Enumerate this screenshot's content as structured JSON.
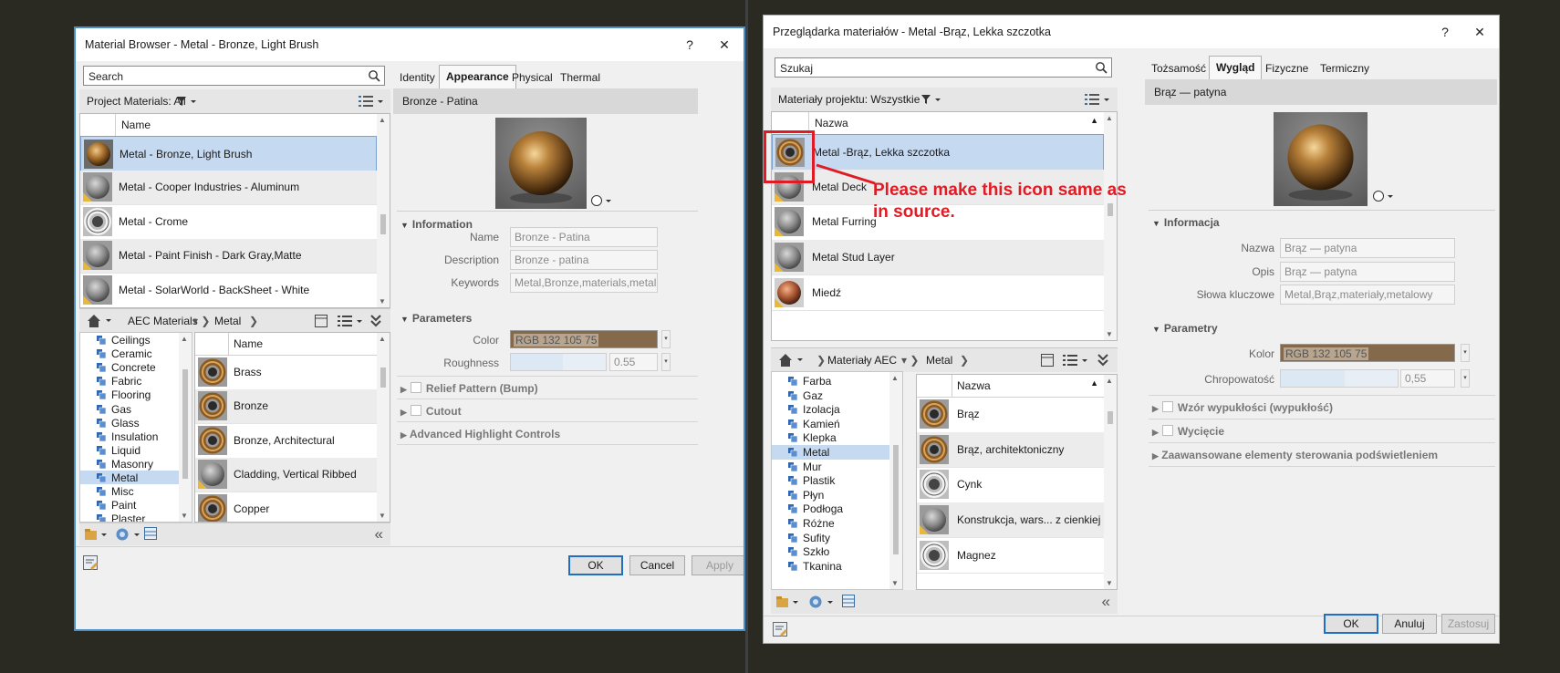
{
  "left_window": {
    "title": "Material Browser - Metal - Bronze, Light Brush",
    "help_label": "?",
    "close_label": "✕",
    "search": {
      "placeholder": "Search"
    },
    "project_materials_label": "Project Materials: All",
    "list_header": "Name",
    "project_items": [
      {
        "label": "Metal - Bronze, Light Brush",
        "thumb": "bronze-brush"
      },
      {
        "label": "Metal - Cooper Industries - Aluminum",
        "thumb": "gray-sphere"
      },
      {
        "label": "Metal - Crome",
        "thumb": "chrome-ring"
      },
      {
        "label": "Metal - Paint Finish - Dark Gray,Matte",
        "thumb": "gray-sphere"
      },
      {
        "label": "Metal - SolarWorld - BackSheet - White",
        "thumb": "gray-sphere"
      }
    ],
    "breadcrumb": [
      "AEC Materials",
      "Metal"
    ],
    "tree_items": [
      "Ceilings",
      "Ceramic",
      "Concrete",
      "Fabric",
      "Flooring",
      "Gas",
      "Glass",
      "Insulation",
      "Liquid",
      "Masonry",
      "Metal",
      "Misc",
      "Paint",
      "Plaster"
    ],
    "tree_selected": "Metal",
    "library_header": "Name",
    "library_items": [
      {
        "label": "Brass",
        "thumb": "ring"
      },
      {
        "label": "Bronze",
        "thumb": "ring"
      },
      {
        "label": "Bronze, Architectural",
        "thumb": "ring"
      },
      {
        "label": "Cladding, Vertical Ribbed",
        "thumb": "gray-sphere"
      },
      {
        "label": "Copper",
        "thumb": "ring"
      }
    ],
    "tabs": [
      "Identity",
      "Appearance",
      "Physical",
      "Thermal"
    ],
    "active_tab": "Appearance",
    "asset_name": "Bronze - Patina",
    "information_label": "Information",
    "fields": [
      {
        "label": "Name",
        "value": "Bronze - Patina"
      },
      {
        "label": "Description",
        "value": "Bronze - patina"
      },
      {
        "label": "Keywords",
        "value": "Metal,Bronze,materials,metal"
      }
    ],
    "parameters_label": "Parameters",
    "color_label": "Color",
    "color_value": "RGB 132 105 75",
    "roughness_label": "Roughness",
    "roughness_value": "0.55",
    "collapsed_sections": [
      "Relief Pattern (Bump)",
      "Cutout"
    ],
    "advanced_label": "Advanced Highlight Controls",
    "buttons": {
      "ok": "OK",
      "cancel": "Cancel",
      "apply": "Apply"
    }
  },
  "right_window": {
    "title": "Przeglądarka materiałów - Metal -Brąz, Lekka szczotka",
    "help_label": "?",
    "close_label": "✕",
    "search": {
      "placeholder": "Szukaj"
    },
    "project_materials_label": "Materiały projektu: Wszystkie",
    "list_header": "Nazwa",
    "project_items": [
      {
        "label": "Metal -Brąz, Lekka szczotka",
        "thumb": "ring"
      },
      {
        "label": "Metal Deck",
        "thumb": "gray-sphere"
      },
      {
        "label": "Metal Furring",
        "thumb": "gray-sphere"
      },
      {
        "label": "Metal Stud Layer",
        "thumb": "gray-sphere"
      },
      {
        "label": "Miedź",
        "thumb": "copper-sphere"
      }
    ],
    "breadcrumb": [
      "Materiały AEC",
      "Metal"
    ],
    "tree_items": [
      "Farba",
      "Gaz",
      "Izolacja",
      "Kamień",
      "Klepka",
      "Metal",
      "Mur",
      "Plastik",
      "Płyn",
      "Podłoga",
      "Różne",
      "Sufity",
      "Szkło",
      "Tkanina"
    ],
    "tree_selected": "Metal",
    "library_header": "Nazwa",
    "library_items": [
      {
        "label": "Brąz",
        "thumb": "ring"
      },
      {
        "label": "Brąz, architektoniczny",
        "thumb": "ring"
      },
      {
        "label": "Cynk",
        "thumb": "chrome-ring"
      },
      {
        "label": "Konstrukcja, wars... z cienkiej stali",
        "thumb": "gray-sphere"
      },
      {
        "label": "Magnez",
        "thumb": "chrome-ring"
      }
    ],
    "tabs": [
      "Tożsamość",
      "Wygląd",
      "Fizyczne",
      "Termiczny"
    ],
    "active_tab": "Wygląd",
    "asset_name": "Brąz — patyna",
    "information_label": "Informacja",
    "fields": [
      {
        "label": "Nazwa",
        "value": "Brąz — patyna"
      },
      {
        "label": "Opis",
        "value": "Brąz — patyna"
      },
      {
        "label": "Słowa kluczowe",
        "value": "Metal,Brąz,materiały,metalowy"
      }
    ],
    "parameters_label": "Parametry",
    "color_label": "Kolor",
    "color_value": "RGB 132 105 75",
    "roughness_label": "Chropowatość",
    "roughness_value": "0,55",
    "collapsed_sections": [
      "Wzór wypukłości (wypukłość)",
      "Wycięcie"
    ],
    "advanced_label": "Zaawansowane elementy sterowania podświetleniem",
    "buttons": {
      "ok": "OK",
      "cancel": "Anuluj",
      "apply": "Zastosuj"
    }
  },
  "annotation": {
    "text_line1": "Please make this icon same as",
    "text_line2": "in source.",
    "color": "#e01b24"
  },
  "colors": {
    "selection": "#c5d9f1",
    "swatch": "#84694b",
    "primary_border": "#1f6fc4",
    "window_border_active": "#4a90c8"
  },
  "roughness_fraction": 0.55
}
